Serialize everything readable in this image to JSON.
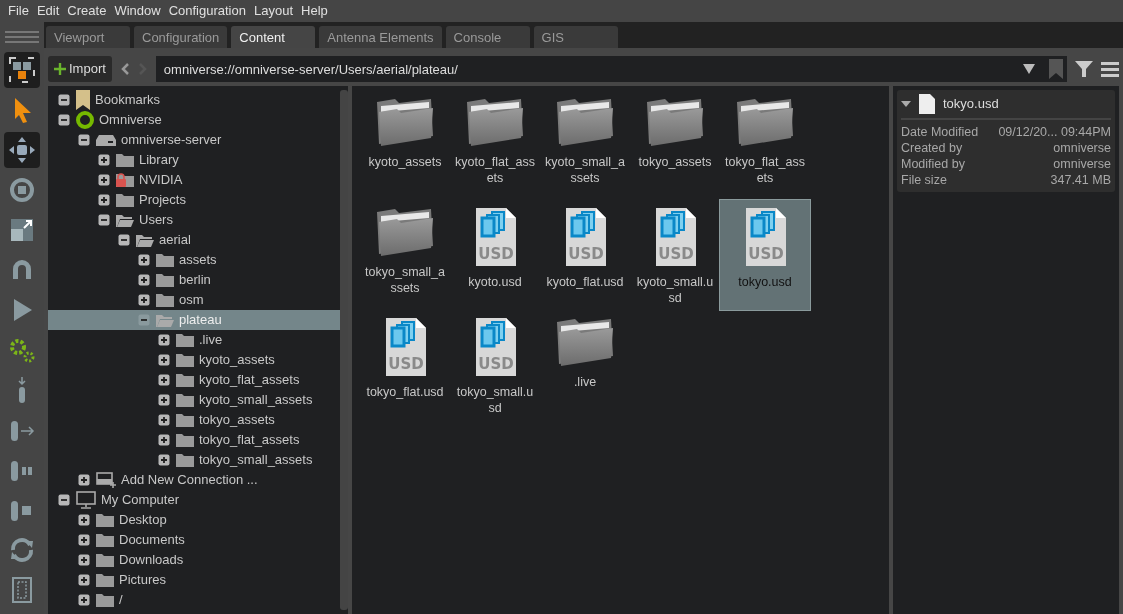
{
  "menu": [
    "File",
    "Edit",
    "Create",
    "Window",
    "Configuration",
    "Layout",
    "Help"
  ],
  "tools": [
    {
      "kind": "scene",
      "selected": true
    },
    {
      "kind": "select",
      "selected": false
    },
    {
      "kind": "move",
      "selected": true
    },
    {
      "kind": "rotate",
      "selected": false
    },
    {
      "kind": "scale",
      "selected": false
    },
    {
      "kind": "snap",
      "selected": false
    },
    {
      "kind": "play",
      "selected": false
    },
    {
      "kind": "gears",
      "selected": false
    },
    {
      "kind": "drop",
      "selected": false
    },
    {
      "kind": "push",
      "selected": false
    },
    {
      "kind": "pause",
      "selected": false
    },
    {
      "kind": "stop",
      "selected": false
    },
    {
      "kind": "refresh",
      "selected": false
    },
    {
      "kind": "panel",
      "selected": false
    }
  ],
  "tabs": [
    {
      "label": "Viewport",
      "selected": false
    },
    {
      "label": "Configuration",
      "selected": false
    },
    {
      "label": "Content",
      "selected": true
    },
    {
      "label": "Antenna Elements",
      "selected": false
    },
    {
      "label": "Console",
      "selected": false
    },
    {
      "label": "GIS",
      "selected": false
    }
  ],
  "toolbar": {
    "import_label": "Import",
    "path": "omniverse://omniverse-server/Users/aerial/plateau/"
  },
  "tree": [
    {
      "label": "Bookmarks",
      "kind": "bookmark",
      "expanded": true,
      "selected": false
    },
    {
      "label": "Omniverse",
      "kind": "omniverse",
      "expanded": true,
      "selected": false,
      "children": [
        {
          "label": "omniverse-server",
          "kind": "server",
          "expanded": true,
          "selected": false,
          "children": [
            {
              "label": "Library",
              "kind": "folder",
              "expanded": false,
              "selected": false
            },
            {
              "label": "NVIDIA",
              "kind": "locked_folder",
              "expanded": false,
              "selected": false
            },
            {
              "label": "Projects",
              "kind": "folder",
              "expanded": false,
              "selected": false
            },
            {
              "label": "Users",
              "kind": "folder",
              "expanded": true,
              "selected": false,
              "children": [
                {
                  "label": "aerial",
                  "kind": "folder",
                  "expanded": true,
                  "selected": false,
                  "children": [
                    {
                      "label": "assets",
                      "kind": "folder",
                      "expanded": false,
                      "selected": false
                    },
                    {
                      "label": "berlin",
                      "kind": "folder",
                      "expanded": false,
                      "selected": false
                    },
                    {
                      "label": "osm",
                      "kind": "folder",
                      "expanded": false,
                      "selected": false
                    },
                    {
                      "label": "plateau",
                      "kind": "folder",
                      "expanded": true,
                      "selected": true,
                      "children": [
                        {
                          "label": ".live",
                          "kind": "folder",
                          "expanded": false,
                          "selected": false
                        },
                        {
                          "label": "kyoto_assets",
                          "kind": "folder",
                          "expanded": false,
                          "selected": false
                        },
                        {
                          "label": "kyoto_flat_assets",
                          "kind": "folder",
                          "expanded": false,
                          "selected": false
                        },
                        {
                          "label": "kyoto_small_assets",
                          "kind": "folder",
                          "expanded": false,
                          "selected": false
                        },
                        {
                          "label": "tokyo_assets",
                          "kind": "folder",
                          "expanded": false,
                          "selected": false
                        },
                        {
                          "label": "tokyo_flat_assets",
                          "kind": "folder",
                          "expanded": false,
                          "selected": false
                        },
                        {
                          "label": "tokyo_small_assets",
                          "kind": "folder",
                          "expanded": false,
                          "selected": false
                        }
                      ]
                    }
                  ]
                }
              ]
            }
          ]
        },
        {
          "label": "Add New Connection ...",
          "kind": "connection",
          "expanded": false,
          "selected": false
        }
      ]
    },
    {
      "label": "My Computer",
      "kind": "computer",
      "expanded": true,
      "selected": false,
      "children": [
        {
          "label": "Desktop",
          "kind": "folder",
          "expanded": false,
          "selected": false
        },
        {
          "label": "Documents",
          "kind": "folder",
          "expanded": false,
          "selected": false
        },
        {
          "label": "Downloads",
          "kind": "folder",
          "expanded": false,
          "selected": false
        },
        {
          "label": "Pictures",
          "kind": "folder",
          "expanded": false,
          "selected": false
        },
        {
          "label": "/",
          "kind": "folder",
          "expanded": false,
          "selected": false
        }
      ]
    }
  ],
  "files": [
    {
      "name": "kyoto_assets",
      "kind": "folder",
      "selected": false
    },
    {
      "name": "kyoto_flat_assets",
      "kind": "folder",
      "selected": false
    },
    {
      "name": "kyoto_small_assets",
      "kind": "folder",
      "selected": false
    },
    {
      "name": "tokyo_assets",
      "kind": "folder",
      "selected": false
    },
    {
      "name": "tokyo_flat_assets",
      "kind": "folder",
      "selected": false
    },
    {
      "name": "tokyo_small_assets",
      "kind": "folder",
      "selected": false
    },
    {
      "name": "kyoto.usd",
      "kind": "usd",
      "icon_text": "USD",
      "selected": false
    },
    {
      "name": "kyoto_flat.usd",
      "kind": "usd",
      "icon_text": "USD",
      "selected": false
    },
    {
      "name": "kyoto_small.usd",
      "kind": "usd",
      "icon_text": "USD",
      "selected": false
    },
    {
      "name": "tokyo.usd",
      "kind": "usd",
      "icon_text": "USD",
      "selected": true
    },
    {
      "name": "tokyo_flat.usd",
      "kind": "usd",
      "icon_text": "USD",
      "selected": false
    },
    {
      "name": "tokyo_small.usd",
      "kind": "usd",
      "icon_text": "USD",
      "selected": false
    },
    {
      "name": ".live",
      "kind": "folder",
      "selected": false
    }
  ],
  "details": {
    "title": "tokyo.usd",
    "expanded": true,
    "rows": [
      {
        "label": "Date Modified",
        "value": "09/12/20... 09:44PM"
      },
      {
        "label": "Created by",
        "value": "omniverse"
      },
      {
        "label": "Modified by",
        "value": "omniverse"
      },
      {
        "label": "File size",
        "value": "347.41 MB"
      }
    ]
  }
}
